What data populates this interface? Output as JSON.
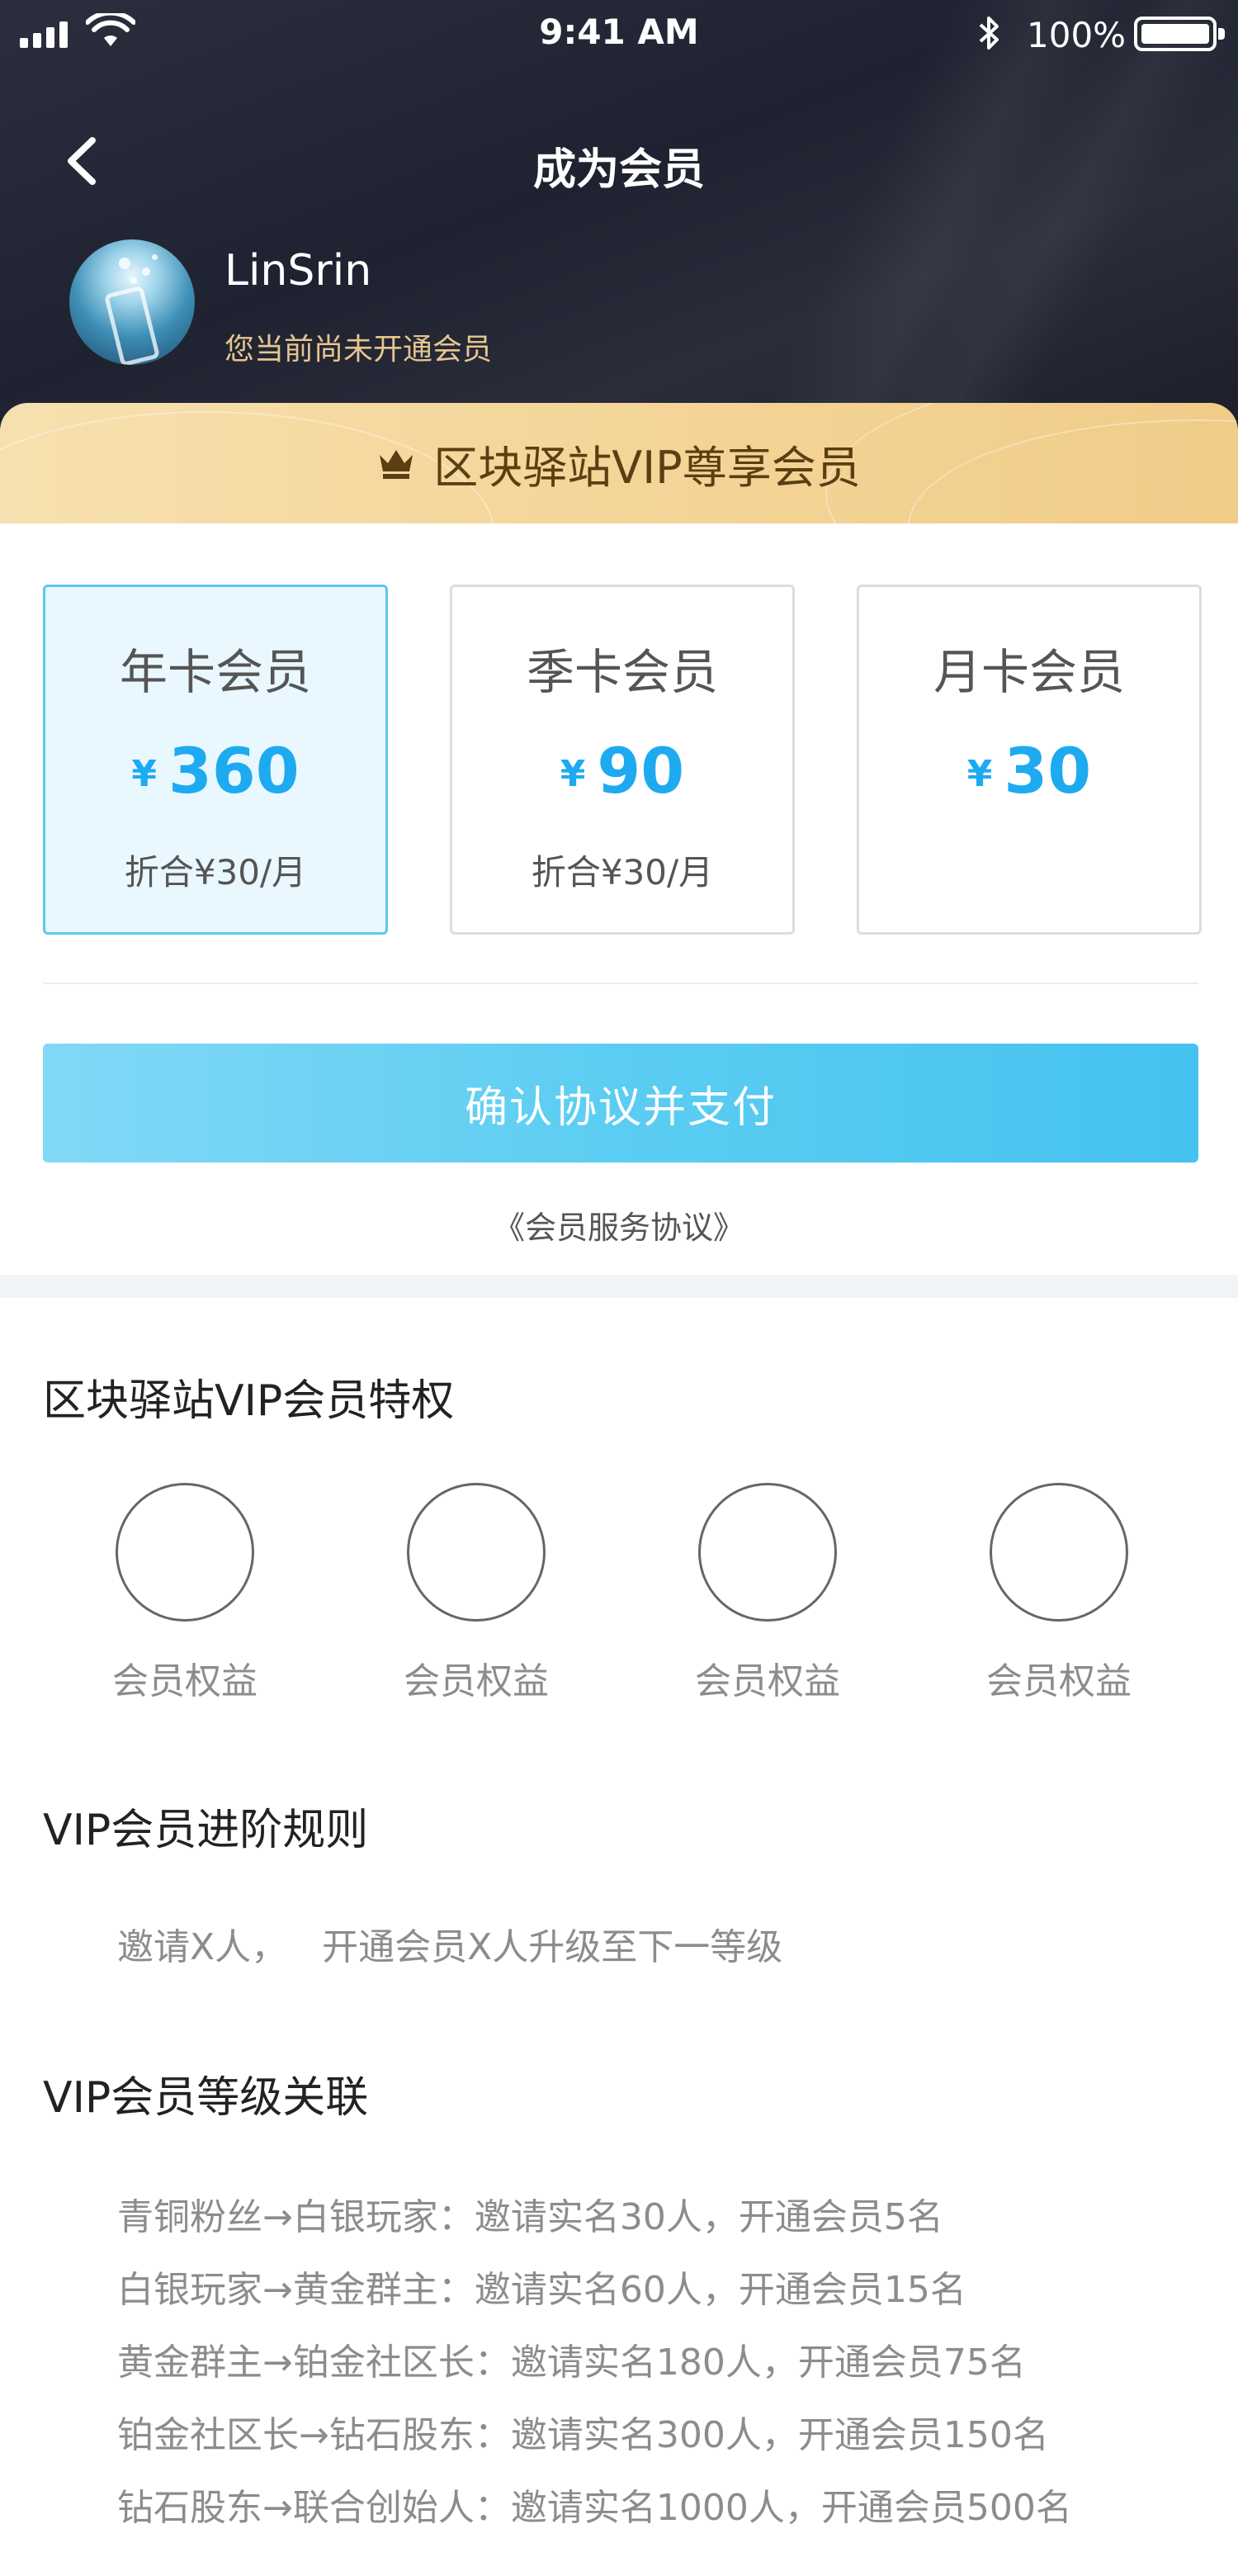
{
  "status_bar": {
    "time": "9:41 AM",
    "battery": "100%"
  },
  "nav": {
    "title": "成为会员"
  },
  "user": {
    "name": "LinSrin",
    "status": "您当前尚未开通会员"
  },
  "vip_banner": {
    "text": "区块驿站VIP尊享会员",
    "icon": "crown-icon"
  },
  "plans": [
    {
      "name": "年卡会员",
      "currency": "¥",
      "price": "360",
      "note": "折合¥30/月",
      "selected": true
    },
    {
      "name": "季卡会员",
      "currency": "¥",
      "price": "90",
      "note": "折合¥30/月",
      "selected": false
    },
    {
      "name": "月卡会员",
      "currency": "¥",
      "price": "30",
      "note": "",
      "selected": false
    }
  ],
  "pay_button": {
    "label": "确认协议并支付"
  },
  "agreement": {
    "label": "《会员服务协议》"
  },
  "perks": {
    "title": "区块驿站VIP会员特权",
    "items": [
      {
        "label": "会员权益"
      },
      {
        "label": "会员权益"
      },
      {
        "label": "会员权益"
      },
      {
        "label": "会员权益"
      }
    ]
  },
  "rules": {
    "title": "VIP会员进阶规则",
    "text": "邀请X人，   开通会员X人升级至下一等级"
  },
  "levels": {
    "title": "VIP会员等级关联",
    "lines": [
      "青铜粉丝→白银玩家：邀请实名30人，开通会员5名",
      "白银玩家→黄金群主：邀请实名60人，开通会员15名",
      "黄金群主→铂金社区长：邀请实名180人，开通会员75名",
      "铂金社区长→钻石股东：邀请实名300人，开通会员150名",
      "钻石股东→联合创始人：邀请实名1000人，开通会员500名"
    ]
  },
  "colors": {
    "accent": "#1eaaf1",
    "gold": "#e6c58f",
    "header_dark": "#23263a",
    "banner_gold": "#f5d79c"
  }
}
